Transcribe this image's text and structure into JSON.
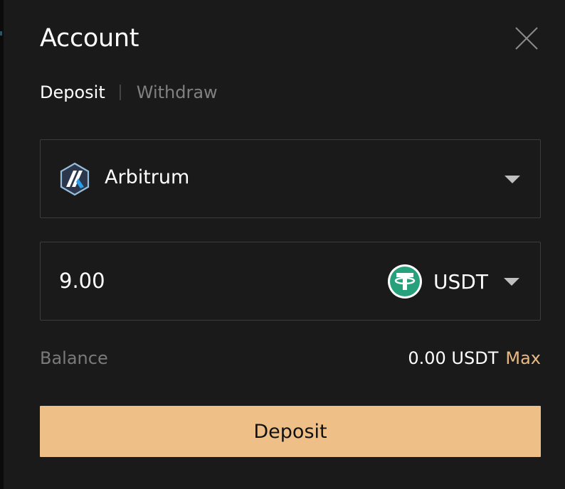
{
  "modal": {
    "title": "Account",
    "close_icon": "close-icon"
  },
  "tabs": [
    {
      "label": "Deposit",
      "active": true
    },
    {
      "label": "Withdraw",
      "active": false
    }
  ],
  "network": {
    "name": "Arbitrum",
    "icon": "arbitrum-logo-icon",
    "dropdown_icon": "chevron-down-icon"
  },
  "amount": {
    "value": "9.00",
    "token": "USDT",
    "token_icon": "usdt-logo-icon"
  },
  "balance": {
    "label": "Balance",
    "value": "0.00 USDT",
    "max_label": "Max"
  },
  "primary_action": {
    "label": "Deposit"
  },
  "colors": {
    "background": "#1a1a1a",
    "accent": "#efbf88",
    "max_link": "#e9b984",
    "muted_text": "#808080",
    "border": "#3d3d3d",
    "usdt_green": "#26a17b",
    "arbitrum_blue": "#28a0f0",
    "arbitrum_navy": "#2d374b"
  }
}
